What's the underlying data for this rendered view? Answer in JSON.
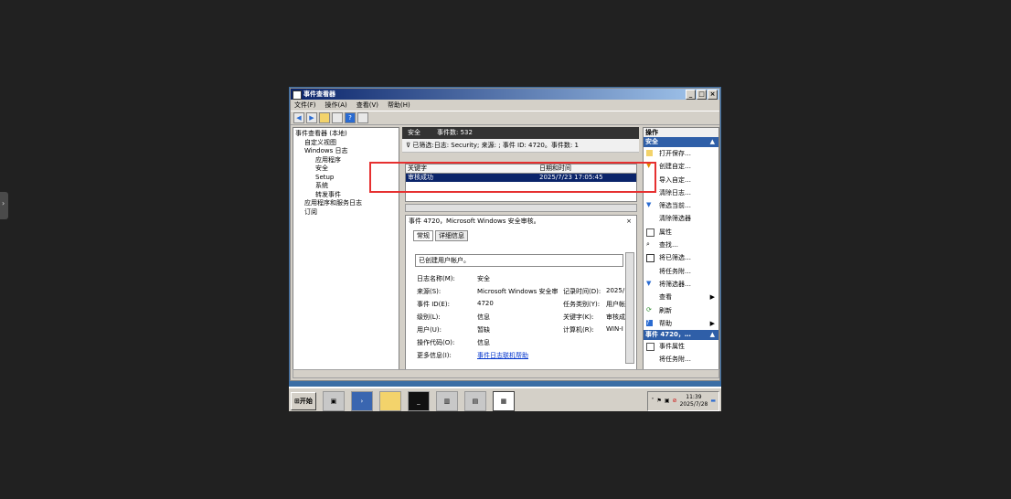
{
  "window": {
    "title": "事件查看器",
    "min": "_",
    "max": "□",
    "close": "×"
  },
  "menu": [
    "文件(F)",
    "操作(A)",
    "查看(V)",
    "帮助(H)"
  ],
  "tree": {
    "root": "事件查看器 (本地)",
    "custom_views": "自定义视图",
    "windows_logs": "Windows 日志",
    "app": "应用程序",
    "security": "安全",
    "setup": "Setup",
    "system": "系统",
    "forwarded": "转发事件",
    "app_services": "应用程序和服务日志",
    "subscriptions": "订阅"
  },
  "main": {
    "log_name": "安全",
    "event_count": "事件数: 532",
    "filter_text": "已筛选:日志: Security; 来源: ; 事件 ID: 4720。事件数: 1",
    "col_keyword": "关键字",
    "col_datetime": "日期和时间",
    "row_keyword": "审核成功",
    "row_datetime": "2025/7/23 17:05:45"
  },
  "detail": {
    "title": "事件 4720，Microsoft Windows 安全审核。",
    "close": "×",
    "tab_general": "常规",
    "tab_details": "详细信息",
    "summary": "已创建用户帐户。",
    "log_name_label": "日志名称(M):",
    "log_name_value": "安全",
    "source_label": "来源(S):",
    "source_value": "Microsoft Windows 安全审",
    "logged_label": "记录时间(D):",
    "logged_value": "2025/",
    "event_id_label": "事件 ID(E):",
    "event_id_value": "4720",
    "task_label": "任务类别(Y):",
    "task_value": "用户帐",
    "level_label": "级别(L):",
    "level_value": "信息",
    "keywords_label": "关键字(K):",
    "keywords_value": "审核成",
    "user_label": "用户(U):",
    "user_value": "暂缺",
    "computer_label": "计算机(R):",
    "computer_value": "WIN-I",
    "opcode_label": "操作代码(O):",
    "opcode_value": "信息",
    "more_label": "更多信息(I):",
    "more_value": "事件日志联机帮助"
  },
  "actions": {
    "header": "操作",
    "section1": "安全",
    "items": [
      "打开保存…",
      "创建自定…",
      "导入自定…",
      "清除日志…",
      "筛选当前…",
      "清除筛选器",
      "属性",
      "查找…",
      "将已筛选…",
      "将任务附…",
      "将筛选器…",
      "查看",
      "刷新",
      "帮助"
    ],
    "section2": "事件 4720，…",
    "items2": [
      "事件属性",
      "将任务附…"
    ]
  },
  "taskbar": {
    "start": "开始",
    "time": "11:39",
    "date": "2025/7/28"
  }
}
